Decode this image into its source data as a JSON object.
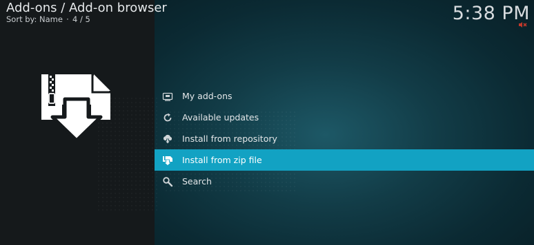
{
  "header": {
    "title": "Add-ons / Add-on browser",
    "sort_label": "Sort by: Name",
    "separator": "·",
    "position": "4 / 5"
  },
  "clock": {
    "time": "5:38 PM"
  },
  "status": {
    "mute_icon": "mute-icon",
    "mute_color": "#c0392b"
  },
  "preview": {
    "icon": "zip-download-icon"
  },
  "menu": {
    "selected_index": 3,
    "accent_color": "#12a2c3",
    "items": [
      {
        "label": "My add-ons",
        "icon": "addon-box-icon"
      },
      {
        "label": "Available updates",
        "icon": "refresh-icon"
      },
      {
        "label": "Install from repository",
        "icon": "cloud-download-icon"
      },
      {
        "label": "Install from zip file",
        "icon": "zip-file-icon"
      },
      {
        "label": "Search",
        "icon": "search-icon"
      }
    ]
  }
}
